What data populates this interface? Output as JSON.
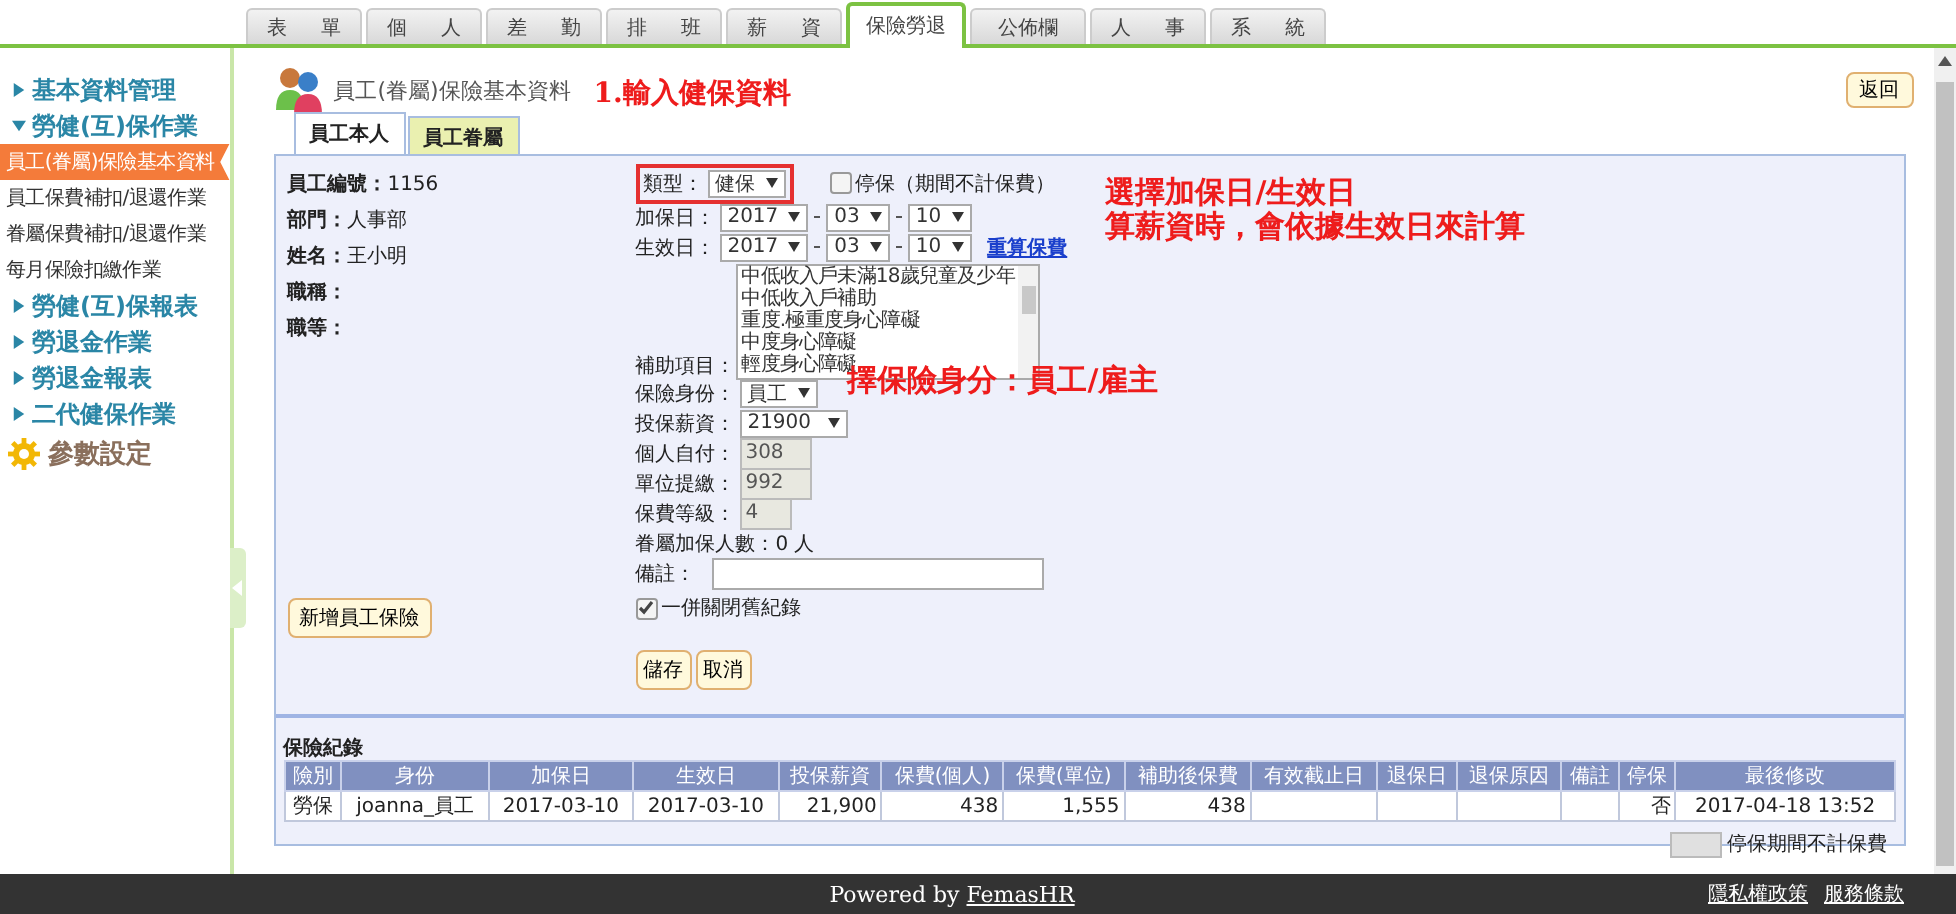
{
  "top_tabs": [
    {
      "label": "表 單",
      "selected": false
    },
    {
      "label": "個 人",
      "selected": false
    },
    {
      "label": "差 勤",
      "selected": false
    },
    {
      "label": "排 班",
      "selected": false
    },
    {
      "label": "薪 資",
      "selected": false
    },
    {
      "label": "保險勞退",
      "selected": true
    },
    {
      "label": "公佈欄",
      "selected": false
    },
    {
      "label": "人 事",
      "selected": false
    },
    {
      "label": "系 統",
      "selected": false
    }
  ],
  "sidebar": {
    "items": [
      {
        "kind": "section",
        "label": "基本資料管理",
        "expanded": false
      },
      {
        "kind": "section",
        "label": "勞健(互)保作業",
        "expanded": true
      },
      {
        "kind": "item",
        "label": "員工(眷屬)保險基本資料",
        "selected": true
      },
      {
        "kind": "item",
        "label": "員工保費補扣/退還作業",
        "selected": false
      },
      {
        "kind": "item",
        "label": "眷屬保費補扣/退還作業",
        "selected": false
      },
      {
        "kind": "item",
        "label": "每月保險扣繳作業",
        "selected": false
      },
      {
        "kind": "section",
        "label": "勞健(互)保報表",
        "expanded": false
      },
      {
        "kind": "section",
        "label": "勞退金作業",
        "expanded": false
      },
      {
        "kind": "section",
        "label": "勞退金報表",
        "expanded": false
      },
      {
        "kind": "section",
        "label": "二代健保作業",
        "expanded": false
      },
      {
        "kind": "settings",
        "label": "參數設定"
      }
    ]
  },
  "page_title": "員工(眷屬)保險基本資料",
  "back_button": "返回",
  "form_tabs": [
    {
      "label": "員工本人",
      "selected": true
    },
    {
      "label": "員工眷屬",
      "selected": false
    }
  ],
  "employee_info": [
    {
      "label": "員工編號：",
      "value": "1156"
    },
    {
      "label": "部門：",
      "value": "人事部"
    },
    {
      "label": "姓名：",
      "value": "王小明"
    },
    {
      "label": "職稱："
    },
    {
      "label": "職等："
    }
  ],
  "form": {
    "type": {
      "label": "類型：",
      "value": "健保"
    },
    "suspend": {
      "label": "停保（期間不計保費）",
      "checked": false
    },
    "join_date": {
      "label": "加保日：",
      "year": "2017",
      "month": "03",
      "day": "10"
    },
    "effective_date": {
      "label": "生效日：",
      "year": "2017",
      "month": "03",
      "day": "10"
    },
    "recalc_link": "重算保費",
    "subsidy": {
      "label": "補助項目：",
      "options": [
        "中低收入戶未滿18歲兒童及少年",
        "中低收入戶補助",
        "重度.極重度身心障礙",
        "中度身心障礙",
        "輕度身心障礙"
      ]
    },
    "identity": {
      "label": "保險身份：",
      "value": "員工"
    },
    "salary": {
      "label": "投保薪資：",
      "value": "21900"
    },
    "personal": {
      "label": "個人自付：",
      "value": "308"
    },
    "unit": {
      "label": "單位提繳：",
      "value": "992"
    },
    "grade": {
      "label": "保費等級：",
      "value": "4"
    },
    "dependents": "眷屬加保人數：0 人",
    "remark": {
      "label": "備註："
    },
    "close_old": {
      "label": "一併關閉舊紀錄",
      "checked": true
    },
    "buttons": [
      "儲存",
      "取消"
    ]
  },
  "add_button": "新增員工保險",
  "annotations": [
    "1.輸入健保資料",
    "選擇加保日/生效日",
    "算薪資時，會依據生效日來計算",
    "擇保險身分：員工/雇主"
  ],
  "records": {
    "title": "保險紀錄",
    "columns": [
      "險別",
      "身份",
      "加保日",
      "生效日",
      "投保薪資",
      "保費(個人)",
      "保費(單位)",
      "補助後保費",
      "有效截止日",
      "退保日",
      "退保原因",
      "備註",
      "停保",
      "最後修改"
    ],
    "rows": [
      [
        "勞保",
        "joanna_員工",
        "2017-03-10",
        "2017-03-10",
        "21,900",
        "438",
        "1,555",
        "438",
        "",
        "",
        "",
        "",
        "否",
        "2017-04-18 13:52"
      ]
    ]
  },
  "legend": "停保期間不計保費",
  "footer": {
    "prefix": "Powered by ",
    "link": "FemasHR",
    "links": [
      "隱私權政策",
      "服務條款"
    ]
  }
}
